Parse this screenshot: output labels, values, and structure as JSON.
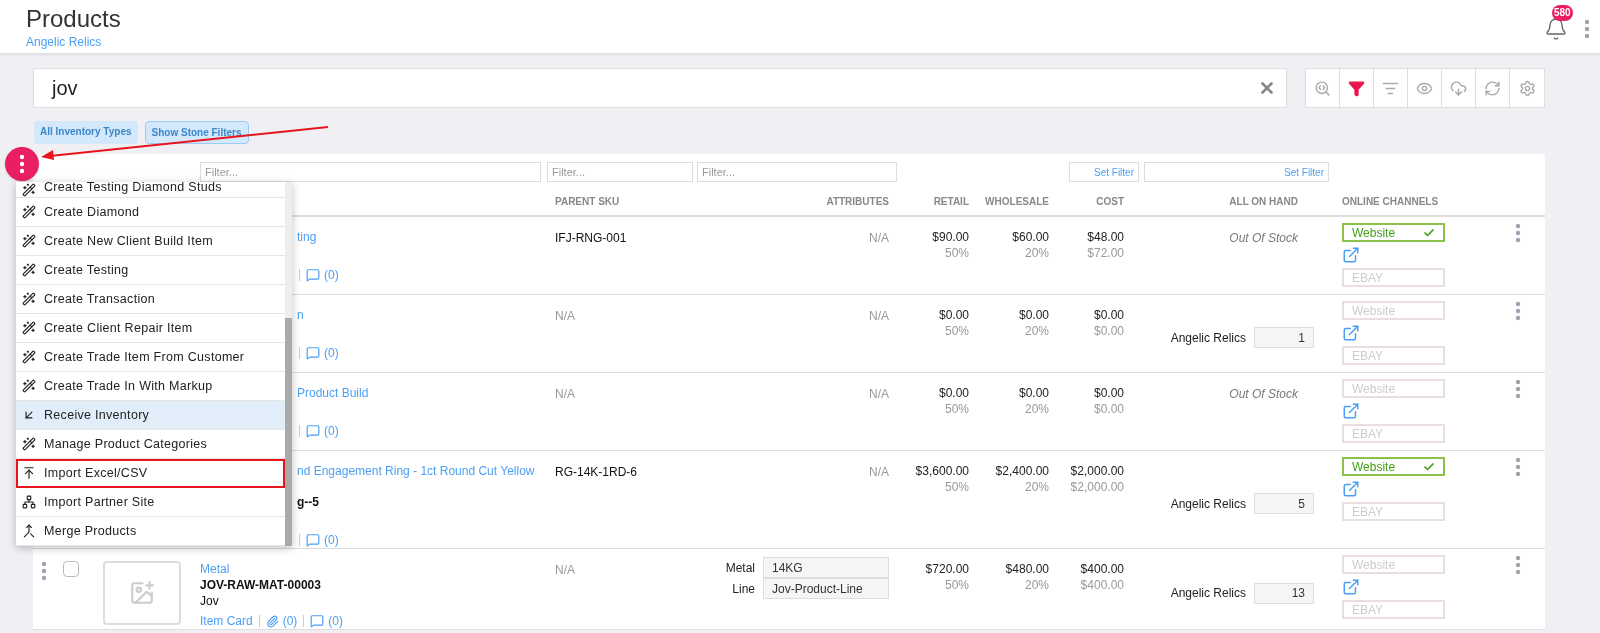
{
  "header": {
    "title": "Products",
    "subtitle": "Angelic Relics",
    "notification_count": "580"
  },
  "search": {
    "value": "jov"
  },
  "toolbar": [
    {
      "kind": "search-settings",
      "selected": false
    },
    {
      "kind": "filter",
      "selected": true
    },
    {
      "kind": "sort",
      "selected": false
    },
    {
      "kind": "eye",
      "selected": false
    },
    {
      "kind": "cloud",
      "selected": false
    },
    {
      "kind": "refresh",
      "selected": false
    },
    {
      "kind": "gear",
      "selected": false
    }
  ],
  "chips": [
    "All Inventory Types",
    "Show Stone Filters"
  ],
  "filters": {
    "placeholders": [
      "Filter...",
      "Filter...",
      "Filter..."
    ],
    "set_filters": [
      "Set Filter",
      "Set Filter"
    ]
  },
  "columns": {
    "parent_sku": "PARENT SKU",
    "attributes": "ATTRIBUTES",
    "retail": "RETAIL",
    "wholesale": "WHOLESALE",
    "cost": "COST",
    "on_hand": "ALL ON HAND",
    "channels": "ONLINE CHANNELS"
  },
  "rows": [
    {
      "title_fragment": "ting",
      "chat": "(0)",
      "parent_sku": {
        "text": "IFJ-RNG-001",
        "muted": false
      },
      "attributes": {
        "kind": "text",
        "text": "N/A"
      },
      "retail": [
        "$90.00",
        "50%"
      ],
      "wholesale": [
        "$60.00",
        "20%"
      ],
      "cost": [
        "$48.00",
        "$72.00"
      ],
      "on_hand": {
        "kind": "status",
        "text": "Out Of Stock"
      },
      "website": {
        "label": "Website",
        "on": true
      },
      "ebay": "EBAY"
    },
    {
      "title_fragment": "n",
      "chat": "(0)",
      "parent_sku": {
        "text": "N/A",
        "muted": true
      },
      "attributes": {
        "kind": "text",
        "text": "N/A"
      },
      "retail": [
        "$0.00",
        "50%"
      ],
      "wholesale": [
        "$0.00",
        "20%"
      ],
      "cost": [
        "$0.00",
        "$0.00"
      ],
      "on_hand": {
        "kind": "qty",
        "location": "Angelic Relics",
        "value": "1"
      },
      "website": {
        "label": "Website",
        "on": false
      },
      "ebay": "EBAY"
    },
    {
      "title_fragment": "Product Build",
      "chat": "(0)",
      "parent_sku": {
        "text": "N/A",
        "muted": true
      },
      "attributes": {
        "kind": "text",
        "text": "N/A"
      },
      "retail": [
        "$0.00",
        "50%"
      ],
      "wholesale": [
        "$0.00",
        "20%"
      ],
      "cost": [
        "$0.00",
        "$0.00"
      ],
      "on_hand": {
        "kind": "status",
        "text": "Out Of Stock"
      },
      "website": {
        "label": "Website",
        "on": false
      },
      "ebay": "EBAY"
    },
    {
      "title_fragment": "nd Engagement Ring - 1ct Round Cut Yellow",
      "sku_fragment": "g--5",
      "chat": "(0)",
      "parent_sku": {
        "text": "RG-14K-1RD-6",
        "muted": false
      },
      "attributes": {
        "kind": "text",
        "text": "N/A"
      },
      "retail": [
        "$3,600.00",
        "50%"
      ],
      "wholesale": [
        "$2,400.00",
        "20%"
      ],
      "cost": [
        "$2,000.00",
        "$2,000.00"
      ],
      "on_hand": {
        "kind": "qty",
        "location": "Angelic Relics",
        "value": "5"
      },
      "website": {
        "label": "Website",
        "on": true
      },
      "ebay": "EBAY"
    },
    {
      "image": {
        "kind": "placeholder"
      },
      "checked": false,
      "title": "Metal",
      "sku": "JOV-RAW-MAT-00003",
      "brand": "Jov",
      "item_card": "Item Card",
      "attachments": "(0)",
      "chat": "(0)",
      "parent_sku": {
        "text": "N/A",
        "muted": true
      },
      "attributes": {
        "kind": "fields",
        "fields": [
          {
            "label": "Metal",
            "value": "14KG"
          },
          {
            "label": "Line",
            "value": "Jov-Product-Line"
          }
        ]
      },
      "retail": [
        "$720.00",
        "50%"
      ],
      "wholesale": [
        "$480.00",
        "20%"
      ],
      "cost": [
        "$400.00",
        "$400.00"
      ],
      "on_hand": {
        "kind": "qty",
        "location": "Angelic Relics",
        "value": "13"
      },
      "website": {
        "label": "Website",
        "on": false
      },
      "ebay": "EBAY"
    }
  ],
  "menu": {
    "items": [
      {
        "label": "Create Testing Diamond Studs",
        "kind": "wand",
        "selected": false,
        "outlined": false
      },
      {
        "label": "Create Diamond",
        "kind": "wand",
        "selected": false,
        "outlined": false
      },
      {
        "label": "Create New Client Build Item",
        "kind": "wand",
        "selected": false,
        "outlined": false
      },
      {
        "label": "Create Testing",
        "kind": "wand",
        "selected": false,
        "outlined": false
      },
      {
        "label": "Create Transaction",
        "kind": "wand",
        "selected": false,
        "outlined": false
      },
      {
        "label": "Create Client Repair Item",
        "kind": "wand",
        "selected": false,
        "outlined": false
      },
      {
        "label": "Create Trade Item From Customer",
        "kind": "wand",
        "selected": false,
        "outlined": false
      },
      {
        "label": "Create Trade In With Markup",
        "kind": "wand",
        "selected": false,
        "outlined": false
      },
      {
        "label": "Receive Inventory",
        "kind": "receive",
        "selected": true,
        "outlined": false
      },
      {
        "label": "Manage Product Categories",
        "kind": "wand",
        "selected": false,
        "outlined": false
      },
      {
        "label": "Import Excel/CSV",
        "kind": "upload",
        "selected": false,
        "outlined": true
      },
      {
        "label": "Import Partner Site",
        "kind": "partner",
        "selected": false,
        "outlined": false
      },
      {
        "label": "Merge Products",
        "kind": "merge",
        "selected": false,
        "outlined": false
      }
    ]
  }
}
